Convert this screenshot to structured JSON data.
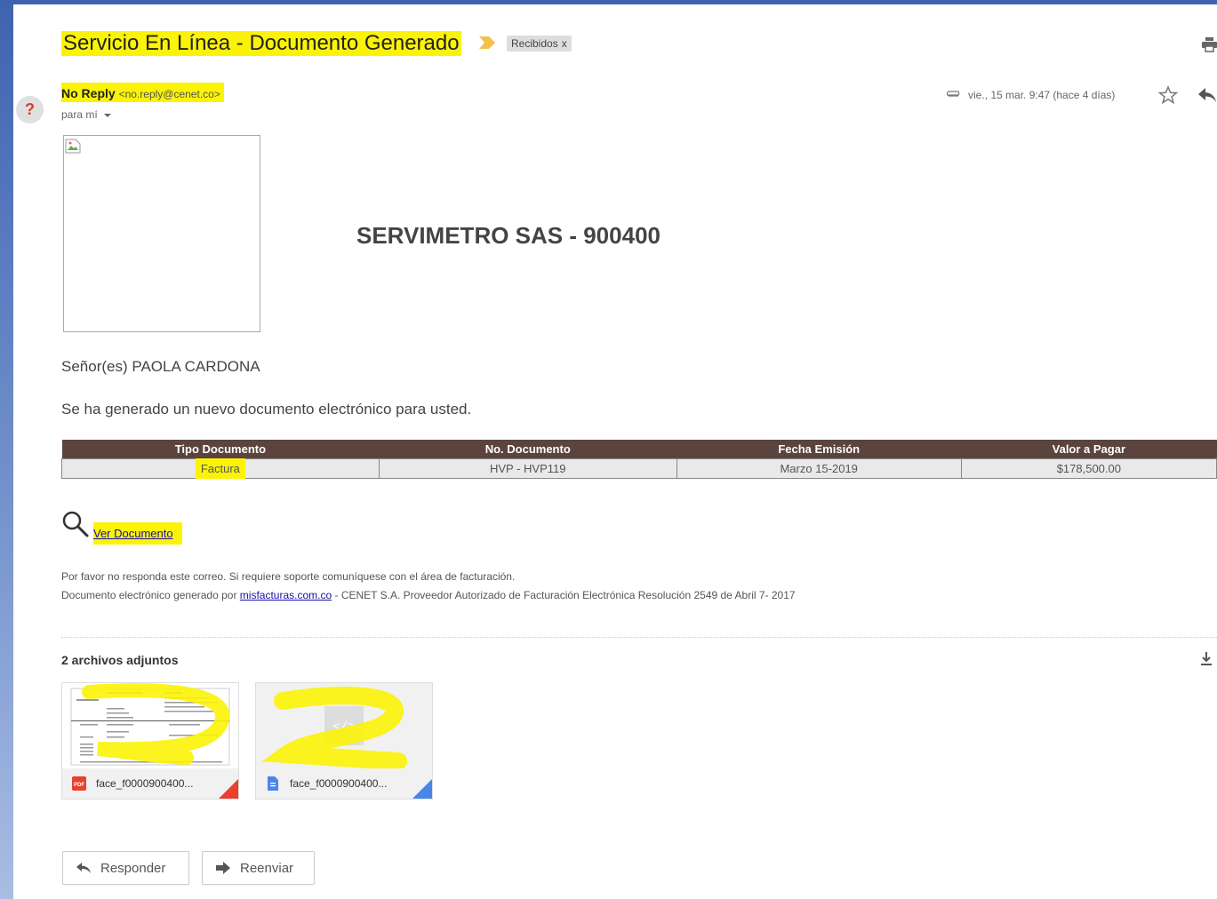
{
  "email": {
    "subject": "Servicio En Línea - Documento Generado",
    "label": "Recibidos",
    "label_close": "x",
    "sender_name": "No Reply",
    "sender_email": "<no.reply@cenet.co>",
    "to_me": "para mí",
    "date": "vie., 15 mar. 9:47 (hace 4 días)",
    "avatar_letter": "?"
  },
  "body": {
    "company": "SERVIMETRO SAS - 900400",
    "greeting": "Señor(es) PAOLA CARDONA",
    "message": "Se ha generado un nuevo documento electrónico para usted.",
    "table": {
      "headers": [
        "Tipo Documento",
        "No. Documento",
        "Fecha Emisión",
        "Valor a Pagar"
      ],
      "row": [
        "Factura",
        "HVP - HVP119",
        "Marzo 15-2019",
        "$178,500.00"
      ]
    },
    "view_link": "Ver Documento",
    "footer_line1": "Por favor no responda este correo. Si requiere soporte comuníquese con el área de facturación.",
    "footer_line2_pre": "Documento electrónico generado por ",
    "footer_link": "misfacturas.com.co",
    "footer_line2_post": " - CENET S.A. Proveedor Autorizado de Facturación Electrónica Resolución 2549 de Abril 7- 2017"
  },
  "attachments": {
    "count_label": "2 archivos adjuntos",
    "items": [
      {
        "name": "face_f0000900400...",
        "type_icon": "pdf-icon",
        "corner_color": "#e8412c"
      },
      {
        "name": "face_f0000900400...",
        "type_icon": "doc-icon",
        "corner_color": "#4a86e8"
      }
    ]
  },
  "actions": {
    "reply": "Responder",
    "forward": "Reenviar"
  },
  "colors": {
    "highlight": "#fbf305",
    "table_header": "#5b443e",
    "link": "#1a0dab"
  }
}
